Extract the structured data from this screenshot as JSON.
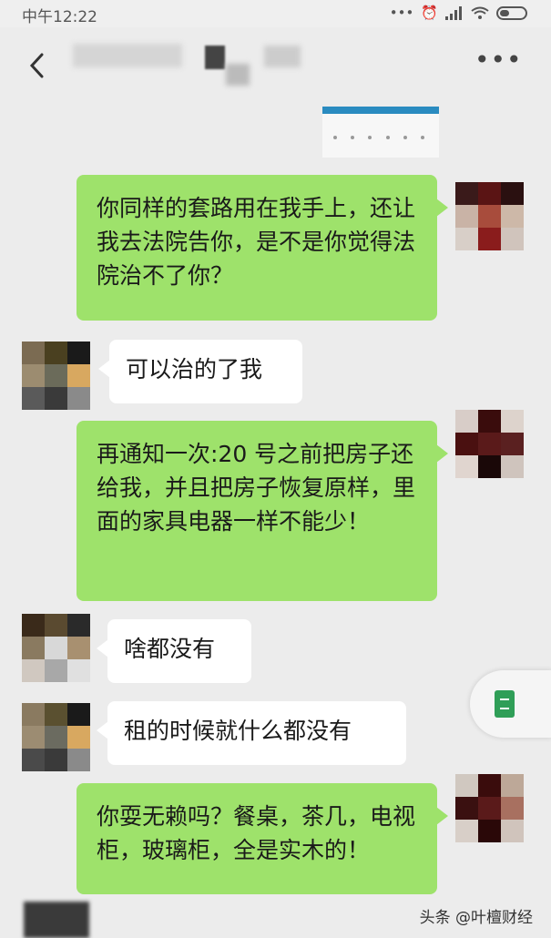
{
  "status_bar": {
    "time": "中午12:22"
  },
  "header": {
    "contact_name": ""
  },
  "messages": [
    {
      "side": "sent",
      "text": "你同样的套路用在我手上，还让我去法院告你，是不是你觉得法院治不了你？"
    },
    {
      "side": "received",
      "text": "可以治的了我"
    },
    {
      "side": "sent",
      "text": "再通知一次:20 号之前把房子还给我，并且把房子恢复原样，里面的家具电器一样不能少！"
    },
    {
      "side": "received",
      "text": "啥都没有"
    },
    {
      "side": "received",
      "text": "租的时候就什么都没有"
    },
    {
      "side": "sent",
      "text": "你耍无赖吗？餐桌，茶几，电视柜，玻璃柜，全是实木的！"
    }
  ],
  "watermark": "头条 @叶檀财经",
  "icons": [
    "back-arrow-icon",
    "more-dots-icon",
    "alarm-icon",
    "signal-icon",
    "wifi-icon",
    "battery-icon",
    "document-icon"
  ],
  "colors": {
    "sent_bubble": "#9ee26b",
    "received_bubble": "#ffffff",
    "background": "#ececec"
  }
}
